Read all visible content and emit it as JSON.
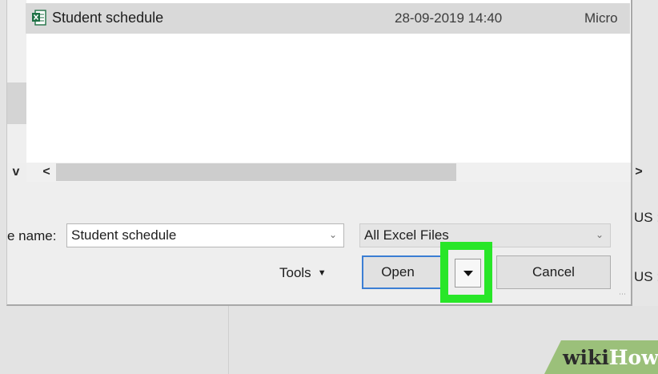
{
  "file_list": {
    "rows": [
      {
        "name": "Student schedule",
        "date_modified": "28-09-2019 14:40",
        "type": "Micro"
      }
    ]
  },
  "scrollbar": {
    "left_arrow": "<",
    "right_arrow": ">",
    "nav_chevron": "v"
  },
  "filename": {
    "label": "e name:",
    "value": "Student schedule"
  },
  "file_type_filter": {
    "selected": "All Excel Files"
  },
  "tools_label": "Tools",
  "buttons": {
    "open": "Open",
    "cancel": "Cancel"
  },
  "background": {
    "right_text_1": "US :",
    "right_text_2": "US :"
  },
  "watermark": {
    "wiki": "wiki",
    "how": "How"
  },
  "colors": {
    "highlight": "#28e628",
    "focus_border": "#3b7ed4",
    "excel_icon": "#1e7145",
    "watermark_bg": "#9bc07a"
  },
  "icons": {
    "file": "excel-file-icon",
    "dropdown": "chevron-down-icon",
    "split_arrow": "triangle-down-icon",
    "resize": "resize-grip-icon"
  }
}
